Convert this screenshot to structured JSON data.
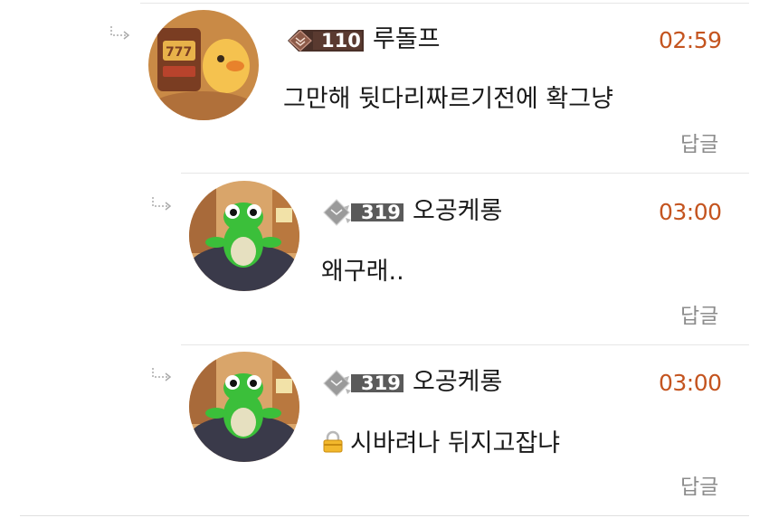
{
  "comments": [
    {
      "level": "110",
      "nickname": "루돌프",
      "time": "02:59",
      "body": "그만해 뒷다리짜르기전에 확그냥",
      "locked": false,
      "reply_label": "답글",
      "avatar_icon": "duck-jackpot-avatar"
    },
    {
      "level": "319",
      "nickname": "오공케롱",
      "time": "03:00",
      "body": "왜구래..",
      "locked": false,
      "reply_label": "답글",
      "avatar_icon": "frog-avatar"
    },
    {
      "level": "319",
      "nickname": "오공케롱",
      "time": "03:00",
      "body": "시바려나  뒤지고잡냐",
      "locked": true,
      "reply_label": "답글",
      "avatar_icon": "frog-avatar"
    }
  ],
  "colors": {
    "time": "#c4541f",
    "reply_link": "#8c8c8c",
    "divider": "#e6e6e6"
  }
}
